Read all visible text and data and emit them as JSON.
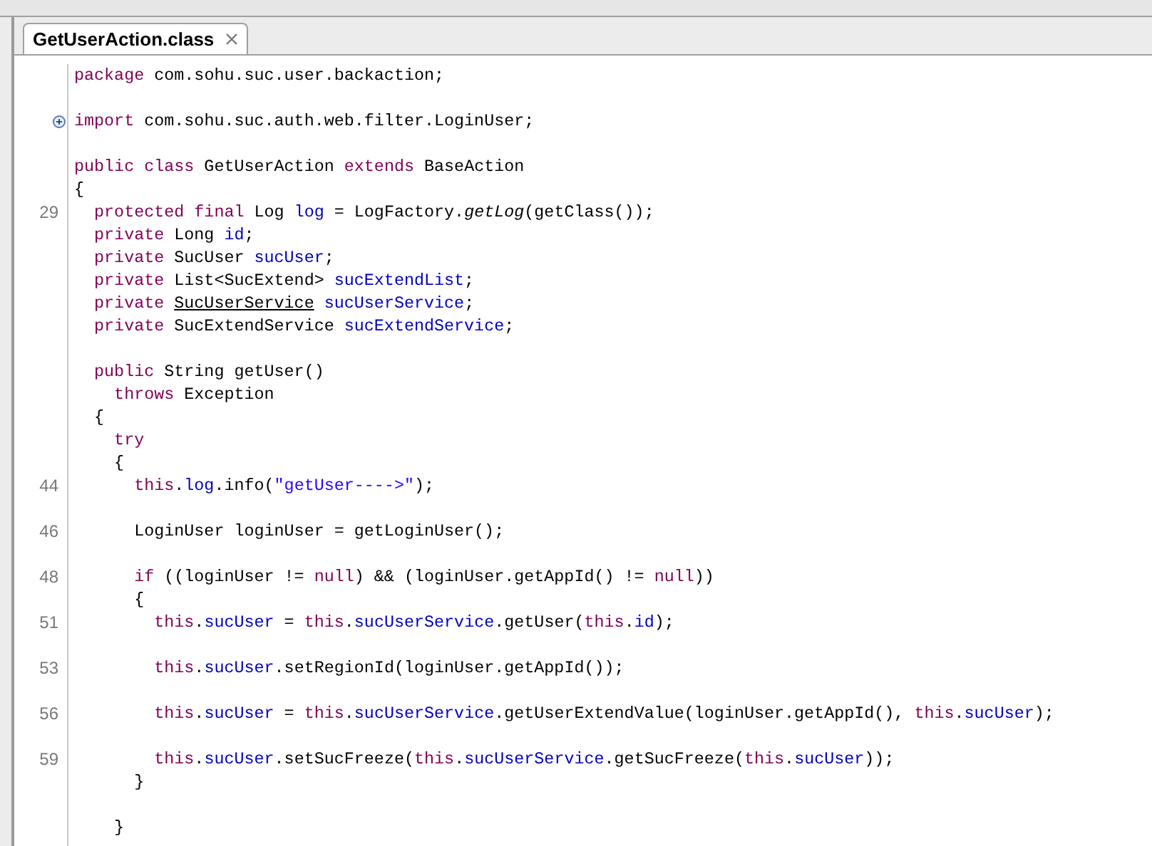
{
  "tab": {
    "label": "GetUserAction.class",
    "selected": true
  },
  "lines": [
    {
      "kind": "code",
      "segments": [
        {
          "text": "package",
          "kind": "keyword"
        },
        {
          "text": " com.sohu.suc.user.backaction;",
          "kind": "plain"
        }
      ]
    },
    {
      "kind": "blank"
    },
    {
      "kind": "code",
      "fold_marker": true,
      "segments": [
        {
          "text": "import",
          "kind": "keyword"
        },
        {
          "text": " com.sohu.suc.auth.web.filter.LoginUser;",
          "kind": "plain"
        }
      ]
    },
    {
      "kind": "blank"
    },
    {
      "kind": "code",
      "segments": [
        {
          "text": "public class",
          "kind": "keyword"
        },
        {
          "text": " GetUserAction ",
          "kind": "plain"
        },
        {
          "text": "extends",
          "kind": "keyword"
        },
        {
          "text": " BaseAction",
          "kind": "plain"
        }
      ]
    },
    {
      "kind": "code",
      "segments": [
        {
          "text": "{",
          "kind": "plain"
        }
      ]
    },
    {
      "kind": "code",
      "number": "29",
      "segments": [
        {
          "text": "  protected final",
          "kind": "keyword"
        },
        {
          "text": " Log ",
          "kind": "plain"
        },
        {
          "text": "log",
          "kind": "field"
        },
        {
          "text": " = LogFactory.",
          "kind": "plain"
        },
        {
          "text": "getLog",
          "kind": "static"
        },
        {
          "text": "(getClass());",
          "kind": "plain"
        }
      ]
    },
    {
      "kind": "code",
      "segments": [
        {
          "text": "  private",
          "kind": "keyword"
        },
        {
          "text": " Long ",
          "kind": "plain"
        },
        {
          "text": "id",
          "kind": "field"
        },
        {
          "text": ";",
          "kind": "plain"
        }
      ]
    },
    {
      "kind": "code",
      "segments": [
        {
          "text": "  private",
          "kind": "keyword"
        },
        {
          "text": " SucUser ",
          "kind": "plain"
        },
        {
          "text": "sucUser",
          "kind": "field"
        },
        {
          "text": ";",
          "kind": "plain"
        }
      ]
    },
    {
      "kind": "code",
      "segments": [
        {
          "text": "  private",
          "kind": "keyword"
        },
        {
          "text": " List<SucExtend> ",
          "kind": "plain"
        },
        {
          "text": "sucExtendList",
          "kind": "field"
        },
        {
          "text": ";",
          "kind": "plain"
        }
      ]
    },
    {
      "kind": "code",
      "segments": [
        {
          "text": "  private ",
          "kind": "keyword"
        },
        {
          "text": "SucUserService",
          "kind": "link"
        },
        {
          "text": " sucUserService",
          "kind": "field"
        },
        {
          "text": ";",
          "kind": "plain"
        }
      ]
    },
    {
      "kind": "code",
      "segments": [
        {
          "text": "  private",
          "kind": "keyword"
        },
        {
          "text": " SucExtendService ",
          "kind": "plain"
        },
        {
          "text": "sucExtendService",
          "kind": "field"
        },
        {
          "text": ";",
          "kind": "plain"
        }
      ]
    },
    {
      "kind": "blank"
    },
    {
      "kind": "code",
      "segments": [
        {
          "text": "  public",
          "kind": "keyword"
        },
        {
          "text": " String getUser()",
          "kind": "plain"
        }
      ]
    },
    {
      "kind": "code",
      "segments": [
        {
          "text": "    throws",
          "kind": "keyword"
        },
        {
          "text": " Exception",
          "kind": "plain"
        }
      ]
    },
    {
      "kind": "code",
      "segments": [
        {
          "text": "  {",
          "kind": "plain"
        }
      ]
    },
    {
      "kind": "code",
      "segments": [
        {
          "text": "    try",
          "kind": "keyword"
        }
      ]
    },
    {
      "kind": "code",
      "segments": [
        {
          "text": "    {",
          "kind": "plain"
        }
      ]
    },
    {
      "kind": "code",
      "number": "44",
      "segments": [
        {
          "text": "      this",
          "kind": "keyword"
        },
        {
          "text": ".",
          "kind": "plain"
        },
        {
          "text": "log",
          "kind": "field"
        },
        {
          "text": ".info(",
          "kind": "plain"
        },
        {
          "text": "\"getUser---->\"",
          "kind": "string"
        },
        {
          "text": ");",
          "kind": "plain"
        }
      ]
    },
    {
      "kind": "blank"
    },
    {
      "kind": "code",
      "number": "46",
      "segments": [
        {
          "text": "      LoginUser loginUser = getLoginUser();",
          "kind": "plain"
        }
      ]
    },
    {
      "kind": "blank"
    },
    {
      "kind": "code",
      "number": "48",
      "segments": [
        {
          "text": "      if",
          "kind": "keyword"
        },
        {
          "text": " ((loginUser != ",
          "kind": "plain"
        },
        {
          "text": "null",
          "kind": "keyword"
        },
        {
          "text": ") && (loginUser.getAppId() != ",
          "kind": "plain"
        },
        {
          "text": "null",
          "kind": "keyword"
        },
        {
          "text": "))",
          "kind": "plain"
        }
      ]
    },
    {
      "kind": "code",
      "segments": [
        {
          "text": "      {",
          "kind": "plain"
        }
      ]
    },
    {
      "kind": "code",
      "number": "51",
      "segments": [
        {
          "text": "        this",
          "kind": "keyword"
        },
        {
          "text": ".",
          "kind": "plain"
        },
        {
          "text": "sucUser",
          "kind": "field"
        },
        {
          "text": " = ",
          "kind": "plain"
        },
        {
          "text": "this",
          "kind": "keyword"
        },
        {
          "text": ".",
          "kind": "plain"
        },
        {
          "text": "sucUserService",
          "kind": "field"
        },
        {
          "text": ".getUser(",
          "kind": "plain"
        },
        {
          "text": "this",
          "kind": "keyword"
        },
        {
          "text": ".",
          "kind": "plain"
        },
        {
          "text": "id",
          "kind": "field"
        },
        {
          "text": ");",
          "kind": "plain"
        }
      ]
    },
    {
      "kind": "blank"
    },
    {
      "kind": "code",
      "number": "53",
      "segments": [
        {
          "text": "        this",
          "kind": "keyword"
        },
        {
          "text": ".",
          "kind": "plain"
        },
        {
          "text": "sucUser",
          "kind": "field"
        },
        {
          "text": ".setRegionId(loginUser.getAppId());",
          "kind": "plain"
        }
      ]
    },
    {
      "kind": "blank"
    },
    {
      "kind": "code",
      "number": "56",
      "segments": [
        {
          "text": "        this",
          "kind": "keyword"
        },
        {
          "text": ".",
          "kind": "plain"
        },
        {
          "text": "sucUser",
          "kind": "field"
        },
        {
          "text": " = ",
          "kind": "plain"
        },
        {
          "text": "this",
          "kind": "keyword"
        },
        {
          "text": ".",
          "kind": "plain"
        },
        {
          "text": "sucUserService",
          "kind": "field"
        },
        {
          "text": ".getUserExtendValue(loginUser.getAppId(), ",
          "kind": "plain"
        },
        {
          "text": "this",
          "kind": "keyword"
        },
        {
          "text": ".",
          "kind": "plain"
        },
        {
          "text": "sucUser",
          "kind": "field"
        },
        {
          "text": ");",
          "kind": "plain"
        }
      ]
    },
    {
      "kind": "blank"
    },
    {
      "kind": "code",
      "number": "59",
      "segments": [
        {
          "text": "        this",
          "kind": "keyword"
        },
        {
          "text": ".",
          "kind": "plain"
        },
        {
          "text": "sucUser",
          "kind": "field"
        },
        {
          "text": ".setSucFreeze(",
          "kind": "plain"
        },
        {
          "text": "this",
          "kind": "keyword"
        },
        {
          "text": ".",
          "kind": "plain"
        },
        {
          "text": "sucUserService",
          "kind": "field"
        },
        {
          "text": ".getSucFreeze(",
          "kind": "plain"
        },
        {
          "text": "this",
          "kind": "keyword"
        },
        {
          "text": ".",
          "kind": "plain"
        },
        {
          "text": "sucUser",
          "kind": "field"
        },
        {
          "text": "));",
          "kind": "plain"
        }
      ]
    },
    {
      "kind": "code",
      "segments": [
        {
          "text": "      }",
          "kind": "plain"
        }
      ]
    },
    {
      "kind": "blank"
    },
    {
      "kind": "code",
      "segments": [
        {
          "text": "    }",
          "kind": "plain"
        }
      ]
    }
  ]
}
